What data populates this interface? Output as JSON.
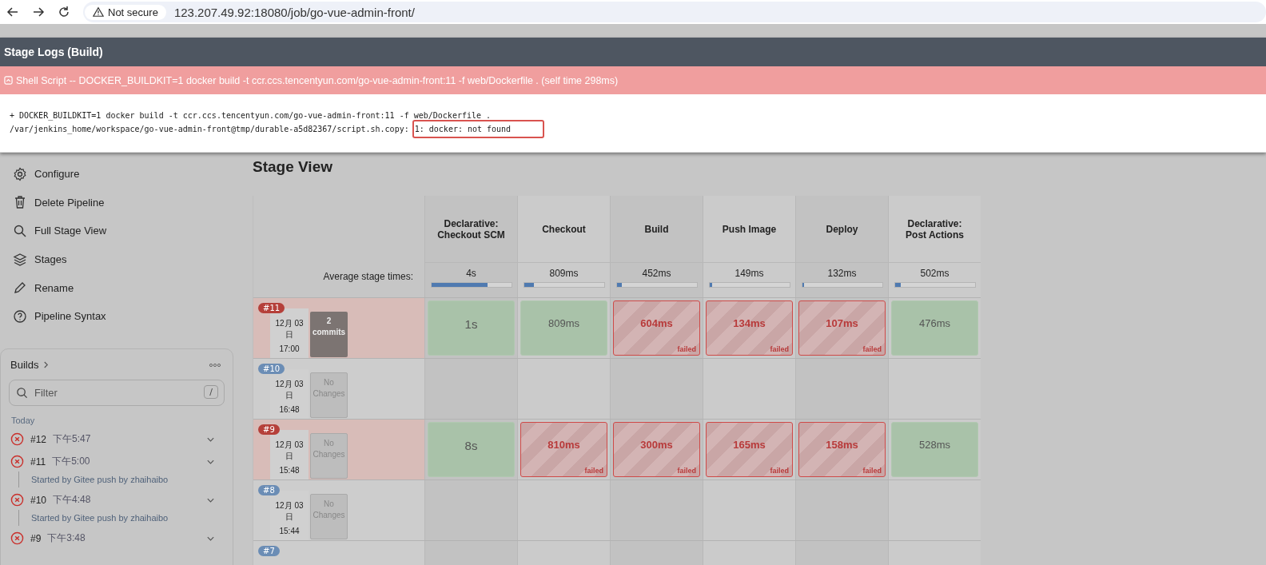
{
  "browser": {
    "security": "Not secure",
    "url": "123.207.49.92:18080/job/go-vue-admin-front/"
  },
  "modal": {
    "title": "Stage Logs (Build)",
    "step": "Shell Script -- DOCKER_BUILDKIT=1 docker build -t ccr.ccs.tencentyun.com/go-vue-admin-front:11 -f web/Dockerfile . (self time 298ms)",
    "failed": true,
    "log": [
      {
        "text": "+ DOCKER_BUILDKIT=1 docker build -t ccr.ccs.tencentyun.com/go-vue-admin-front:11 -f web/Dockerfile ."
      },
      {
        "text": "/var/jenkins_home/workspace/go-vue-admin-front@tmp/durable-a5d82367/script.sh.copy: ",
        "highlight": "1: docker: not found"
      }
    ]
  },
  "sidebar": {
    "items": [
      {
        "label": "Configure",
        "kind": "gear"
      },
      {
        "label": "Delete Pipeline",
        "kind": "trash"
      },
      {
        "label": "Full Stage View",
        "kind": "search"
      },
      {
        "label": "Stages",
        "kind": "layers"
      },
      {
        "label": "Rename",
        "kind": "pencil"
      },
      {
        "label": "Pipeline Syntax",
        "kind": "help"
      }
    ]
  },
  "builds": {
    "title": "Builds",
    "filter_placeholder": "Filter",
    "shortcut": "/",
    "group": "Today",
    "items": [
      {
        "number": "#12",
        "time": "下午5:47",
        "failed": true
      },
      {
        "number": "#11",
        "time": "下午5:00",
        "failed": true,
        "detail": "Started by Gitee push by zhaihaibo"
      },
      {
        "number": "#10",
        "time": "下午4:48",
        "failed": true,
        "detail": "Started by Gitee push by zhaihaibo"
      },
      {
        "number": "#9",
        "time": "下午3:48",
        "failed": true
      }
    ]
  },
  "stage_view": {
    "title": "Stage View",
    "average_label": "Average stage times:",
    "stages": [
      {
        "name": "Declarative: Checkout SCM",
        "average": "4s",
        "level": 0.7
      },
      {
        "name": "Checkout",
        "average": "809ms",
        "level": 0.12
      },
      {
        "name": "Build",
        "average": "452ms",
        "level": 0.06
      },
      {
        "name": "Push Image",
        "average": "149ms",
        "level": 0.03
      },
      {
        "name": "Deploy",
        "average": "132ms",
        "level": 0.02
      },
      {
        "name": "Declarative: Post Actions",
        "average": "502ms",
        "level": 0.07
      }
    ],
    "runs": [
      {
        "build": "#11",
        "date": "12月 03",
        "day": "日",
        "time": "17:00",
        "changes": "2 commits",
        "has_changes": true,
        "failed": true,
        "cells": [
          {
            "time": "1s",
            "failed": false
          },
          {
            "time": "809ms",
            "failed": false
          },
          {
            "time": "604ms",
            "failed": true,
            "note": "failed"
          },
          {
            "time": "134ms",
            "failed": true,
            "note": "failed"
          },
          {
            "time": "107ms",
            "failed": true,
            "note": "failed"
          },
          {
            "time": "476ms",
            "failed": false
          }
        ]
      },
      {
        "build": "#10",
        "date": "12月 03",
        "day": "日",
        "time": "16:48",
        "changes": "No Changes",
        "has_changes": false,
        "failed": false
      },
      {
        "build": "#9",
        "date": "12月 03",
        "day": "日",
        "time": "15:48",
        "changes": "No Changes",
        "has_changes": false,
        "failed": true,
        "cells": [
          {
            "time": "8s",
            "failed": false
          },
          {
            "time": "810ms",
            "failed": true,
            "note": "failed"
          },
          {
            "time": "300ms",
            "failed": true,
            "note": "failed"
          },
          {
            "time": "165ms",
            "failed": true,
            "note": "failed"
          },
          {
            "time": "158ms",
            "failed": true,
            "note": "failed"
          },
          {
            "time": "528ms",
            "failed": false
          }
        ]
      },
      {
        "build": "#8",
        "date": "12月 03",
        "day": "日",
        "time": "15:44",
        "changes": "No Changes",
        "has_changes": false,
        "failed": false
      },
      {
        "build": "#7",
        "failed": false
      }
    ]
  }
}
